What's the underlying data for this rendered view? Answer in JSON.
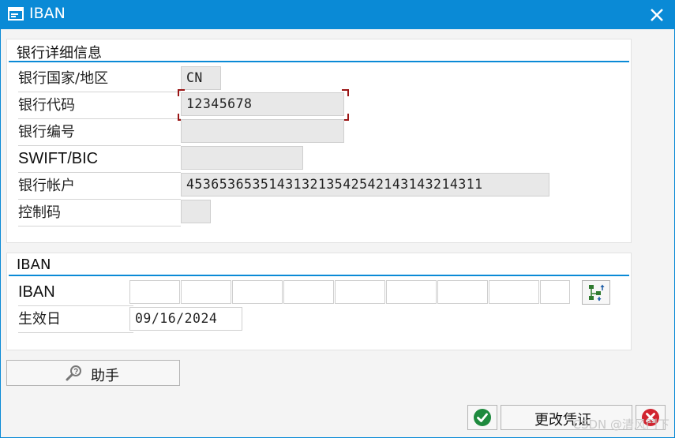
{
  "window": {
    "title": "IBAN"
  },
  "bank_details": {
    "section_title": "银行详细信息",
    "fields": [
      {
        "label": "银行国家/地区",
        "value": "CN"
      },
      {
        "label": "银行代码",
        "value": "12345678"
      },
      {
        "label": "银行编号",
        "value": ""
      },
      {
        "label": "SWIFT/BIC",
        "value": ""
      },
      {
        "label": "银行帐户",
        "value": "453653653514313213542542143143214311"
      },
      {
        "label": "控制码",
        "value": ""
      }
    ]
  },
  "iban": {
    "section_title": "IBAN",
    "iban_label": "IBAN",
    "segments": [
      "",
      "",
      "",
      "",
      "",
      "",
      "",
      "",
      ""
    ],
    "valid_from_label": "生效日",
    "valid_from": "09/16/2024"
  },
  "buttons": {
    "help": "助手",
    "change_voucher": "更改凭证"
  },
  "watermark": "CSDN @清风鬥下"
}
